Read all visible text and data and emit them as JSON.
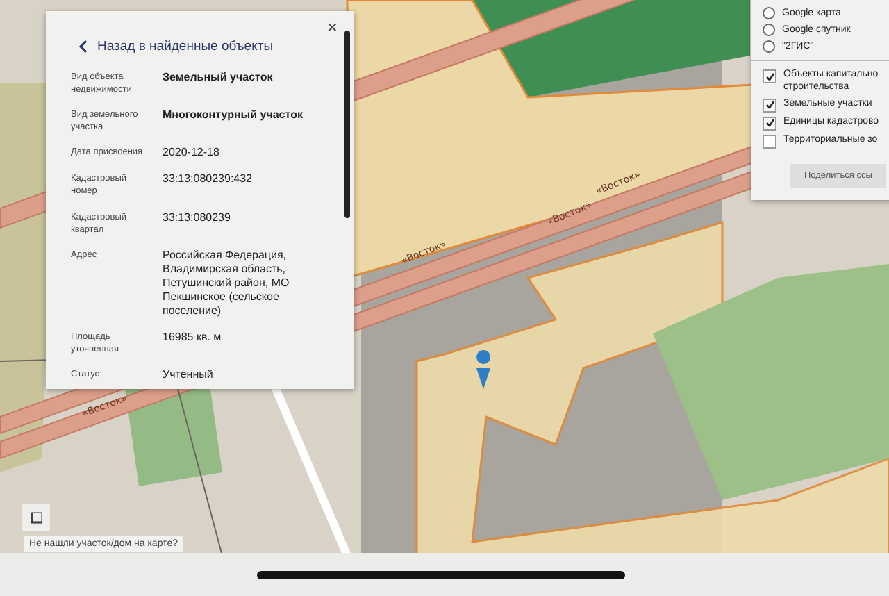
{
  "map": {
    "road_labels": [
      {
        "text": "«Восток»"
      },
      {
        "text": "«Восток»"
      },
      {
        "text": "«Восток»"
      },
      {
        "text": "«Восток»"
      }
    ]
  },
  "info_panel": {
    "close": "×",
    "back_link": "Назад в найденные объекты",
    "fields": [
      {
        "label": "Вид объекта недвижимости",
        "value": "Земельный участок",
        "bold": true
      },
      {
        "label": "Вид земельного участка",
        "value": "Многоконтурный участок",
        "bold": true
      },
      {
        "label": "Дата присвоения",
        "value": "2020-12-18",
        "bold": false
      },
      {
        "label": "Кадастровый номер",
        "value": "33:13:080239:432",
        "bold": false
      },
      {
        "label": "Кадастровый квартал",
        "value": "33:13:080239",
        "bold": false
      },
      {
        "label": "Адрес",
        "value": "Российская Федерация, Владимирская область, Петушинский район, МО Пекшинское (сельское поселение)",
        "bold": false
      },
      {
        "label": "Площадь уточненная",
        "value": "16985 кв. м",
        "bold": false
      },
      {
        "label": "Статус",
        "value": "Учтенный",
        "bold": false
      }
    ]
  },
  "layers_panel": {
    "base_maps": [
      {
        "label": "Google карта",
        "selected": false
      },
      {
        "label": "Google спутник",
        "selected": false
      },
      {
        "label": "\"2ГИС\"",
        "selected": false
      }
    ],
    "layers": [
      {
        "lines": [
          "Объекты капитально",
          "строительства"
        ],
        "checked": true
      },
      {
        "lines": [
          "Земельные участки"
        ],
        "checked": true
      },
      {
        "lines": [
          "Единицы кадастрово"
        ],
        "checked": true
      },
      {
        "lines": [
          "Территориальные зо"
        ],
        "checked": false
      }
    ],
    "share_button": "Поделиться ссы"
  },
  "not_found_link": "Не нашли участок/дом на карте?"
}
